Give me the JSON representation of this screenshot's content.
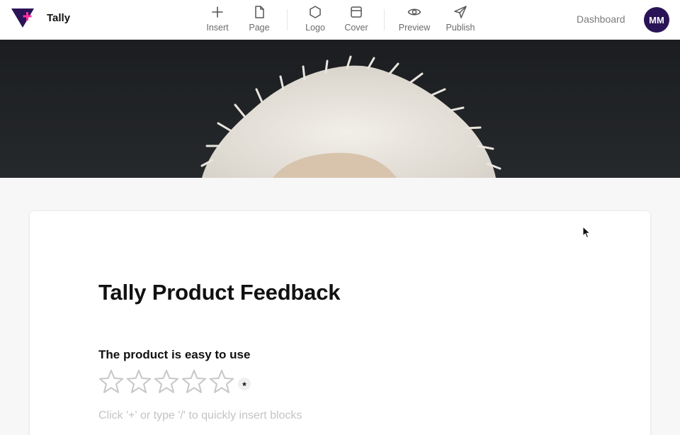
{
  "app": {
    "name": "Tally"
  },
  "toolbar": {
    "items": [
      {
        "label": "Insert",
        "icon": "plus-icon"
      },
      {
        "label": "Page",
        "icon": "page-icon"
      },
      {
        "label": "Logo",
        "icon": "hexagon-icon"
      },
      {
        "label": "Cover",
        "icon": "cover-icon"
      },
      {
        "label": "Preview",
        "icon": "eye-icon"
      },
      {
        "label": "Publish",
        "icon": "send-icon"
      }
    ]
  },
  "header": {
    "dashboard_label": "Dashboard",
    "avatar_initials": "MM"
  },
  "form": {
    "title": "Tally Product Feedback",
    "question": "The product is easy to use",
    "rating": {
      "value": 0,
      "max": 5
    },
    "required_mark": "*",
    "placeholder_hint": "Click '+' or type '/' to quickly insert blocks"
  },
  "colors": {
    "brand_purple": "#2a1457",
    "brand_pink": "#ff2fa0",
    "star_outline": "#c8c8c8",
    "cover_bg": "#1f2124"
  }
}
